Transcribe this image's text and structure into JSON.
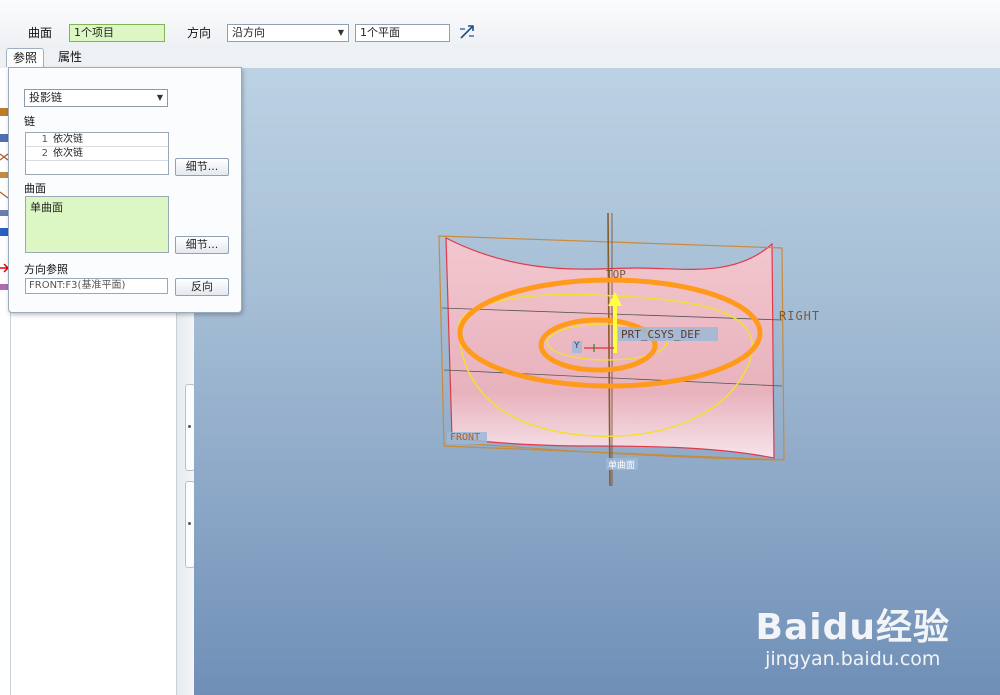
{
  "toolbar": {
    "surface_label": "曲面",
    "surface_value": "1个项目",
    "direction_label": "方向",
    "direction_value": "沿方向",
    "plane_value": "1个平面",
    "flip_icon": "flip-direction-icon"
  },
  "tabs": [
    {
      "label": "参照",
      "active": true
    },
    {
      "label": "属性",
      "active": false
    }
  ],
  "panel": {
    "projection_type": "投影链",
    "chain_label": "链",
    "chains": [
      {
        "num": "1",
        "label": "依次链"
      },
      {
        "num": "2",
        "label": "依次链"
      }
    ],
    "details_button": "细节...",
    "surface_label": "曲面",
    "surface_value": "单曲面",
    "direction_ref_label": "方向参照",
    "direction_ref_value": "FRONT:F3(基准平面)",
    "reverse_button": "反向"
  },
  "model": {
    "top_label": "TOP",
    "right_label": "RIGHT",
    "csys_label": "PRT_CSYS_DEF",
    "front_label": "FRONT",
    "surface_tag": "单曲面",
    "y_label": "Y"
  },
  "watermark": {
    "logo": "Baidu经验",
    "url": "jingyan.baidu.com"
  },
  "colors": {
    "accent_green": "#dcf7c4",
    "viewport_top": "#bcd2e4",
    "viewport_bottom": "#6f8fb7",
    "projected_chain": "#ff9a1a",
    "sketch": "#f2e030",
    "surface": "#efc2c8"
  }
}
